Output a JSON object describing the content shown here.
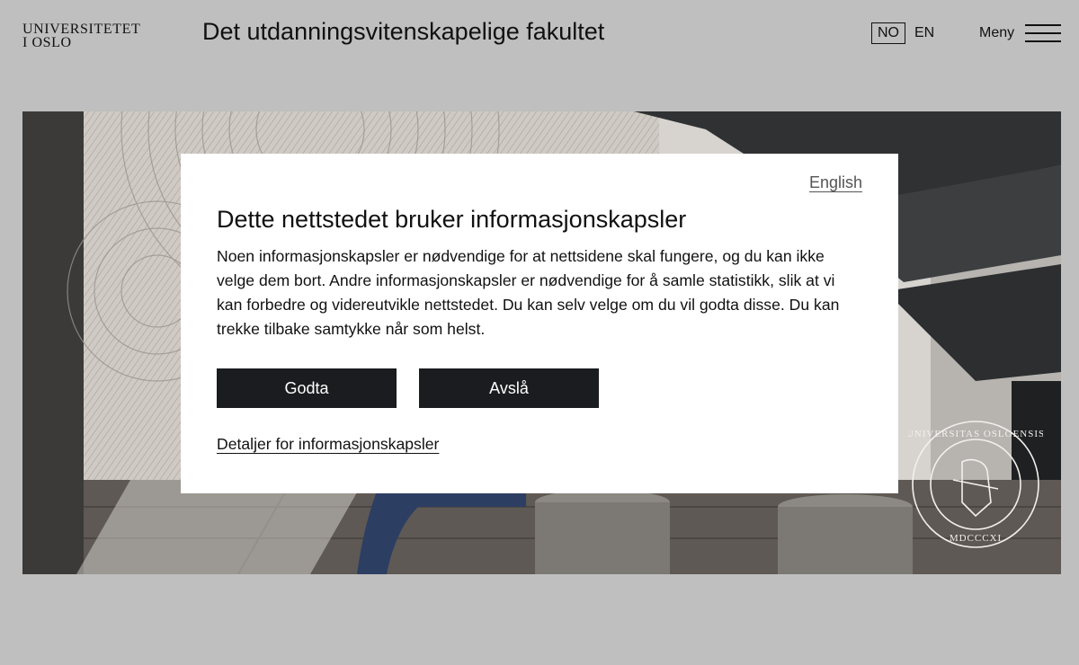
{
  "header": {
    "logo_text": "UNIVERSITETET\nI OSLO",
    "faculty_title": "Det utdanningsvitenskapelige fakultet",
    "lang_no": "NO",
    "lang_en": "EN",
    "menu_label": "Meny"
  },
  "hero": {
    "seal_top": "UNIVERSITAS OSLOENSIS",
    "seal_bottom": "MDCCCXI"
  },
  "cookie_dialog": {
    "english_link": "English",
    "title": "Dette nettstedet bruker informasjonskapsler",
    "body": "Noen informasjonskapsler er nødvendige for at nettsidene skal fungere, og du kan ikke velge dem bort. Andre informasjonskapsler er nødvendige for å samle statistikk, slik at vi kan forbedre og videreutvikle nettstedet. Du kan selv velge om du vil godta disse. Du kan trekke tilbake samtykke når som helst.",
    "accept_label": "Godta",
    "decline_label": "Avslå",
    "details_link": "Detaljer for informasjonskapsler"
  },
  "colors": {
    "page_background": "#bfbfbf",
    "button_background": "#1b1c1f",
    "button_text": "#ffffff",
    "dialog_background": "#ffffff"
  }
}
